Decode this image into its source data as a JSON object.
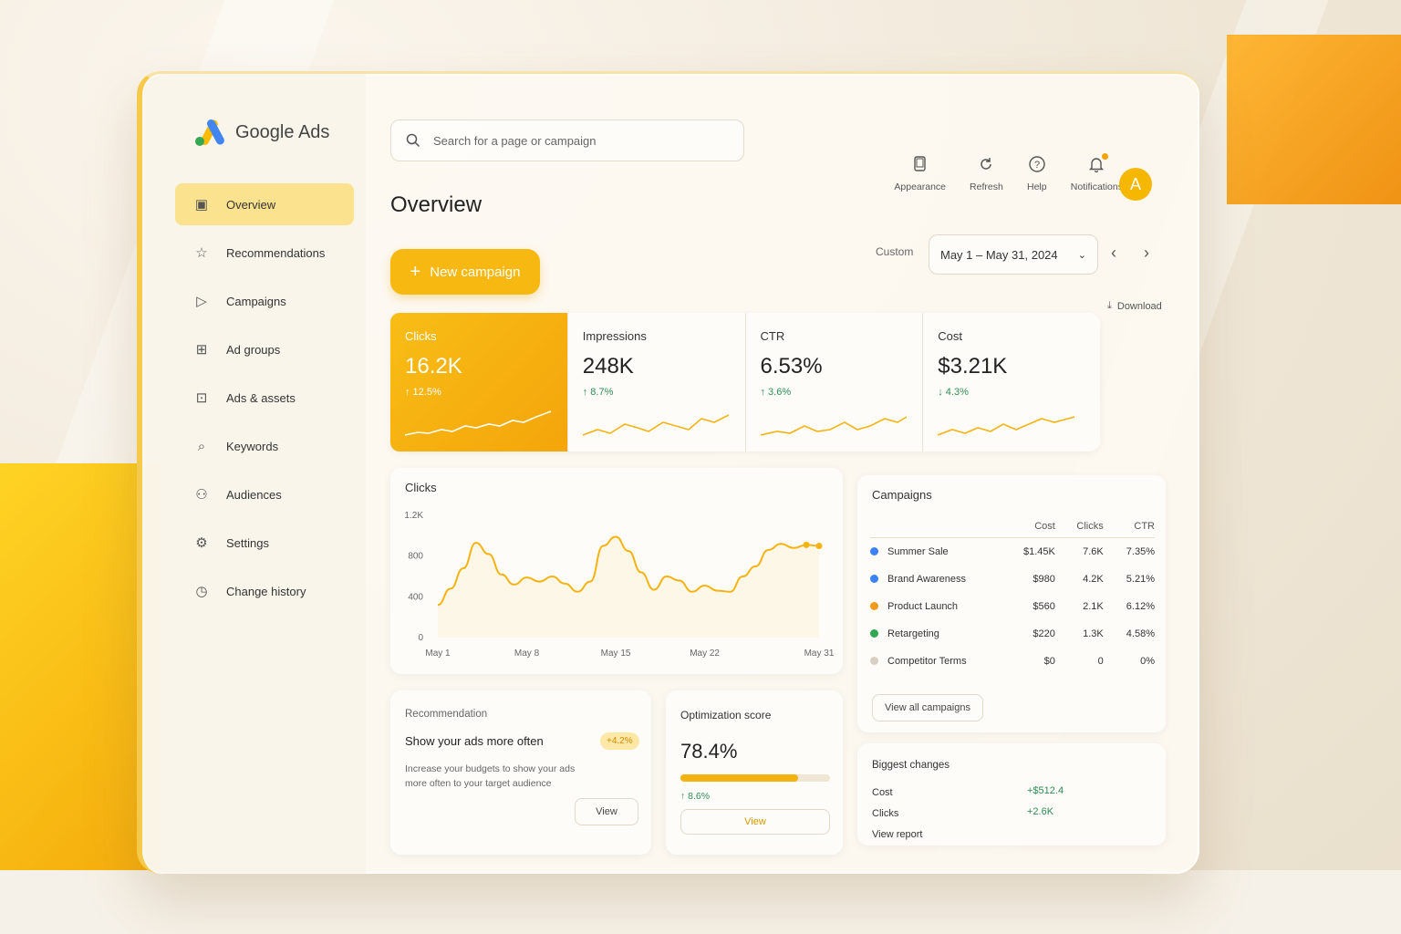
{
  "app": {
    "name": "Google Ads"
  },
  "search": {
    "placeholder": "Search for a page or campaign"
  },
  "sidebar": {
    "items": [
      {
        "label": "Overview",
        "icon": "overview-icon"
      },
      {
        "label": "Recommendations",
        "icon": "star-icon"
      },
      {
        "label": "Campaigns",
        "icon": "campaigns-play-icon"
      },
      {
        "label": "Ad groups",
        "icon": "ad-groups-icon"
      },
      {
        "label": "Ads & assets",
        "icon": "ads-assets-icon"
      },
      {
        "label": "Keywords",
        "icon": "keywords-icon"
      },
      {
        "label": "Audiences",
        "icon": "audiences-icon"
      },
      {
        "label": "Settings",
        "icon": "gear-icon"
      },
      {
        "label": "Change history",
        "icon": "history-icon"
      }
    ]
  },
  "header": {
    "title": "Overview",
    "appearance": "Appearance",
    "refresh": "Refresh",
    "help": "Help",
    "notifications": "Notifications",
    "avatar": "A",
    "new_campaign": "New campaign",
    "range_label": "Custom",
    "date_range": "May 1 – May 31, 2024",
    "download": "Download"
  },
  "kpis": [
    {
      "label": "Clicks",
      "value": "16.2K",
      "delta": "↑ 12.5%"
    },
    {
      "label": "Impressions",
      "value": "248K",
      "delta": "↑ 8.7%"
    },
    {
      "label": "CTR",
      "value": "6.53%",
      "delta": "↑ 3.6%"
    },
    {
      "label": "Cost",
      "value": "$3.21K",
      "delta": "↓ 4.3%"
    }
  ],
  "chart_data": {
    "type": "line",
    "title": "Clicks",
    "x": [
      "May 1",
      "May 2",
      "May 3",
      "May 4",
      "May 5",
      "May 6",
      "May 7",
      "May 8",
      "May 9",
      "May 10",
      "May 11",
      "May 12",
      "May 13",
      "May 14",
      "May 15",
      "May 16",
      "May 17",
      "May 18",
      "May 19",
      "May 20",
      "May 21",
      "May 22",
      "May 23",
      "May 24",
      "May 25",
      "May 26",
      "May 27",
      "May 28",
      "May 29",
      "May 30",
      "May 31"
    ],
    "xticks": [
      "May 1",
      "May 8",
      "May 15",
      "May 22",
      "May 31"
    ],
    "series": [
      {
        "values": [
          320,
          480,
          680,
          930,
          820,
          620,
          520,
          590,
          550,
          600,
          530,
          450,
          550,
          900,
          990,
          850,
          640,
          470,
          600,
          560,
          450,
          510,
          460,
          450,
          600,
          700,
          860,
          920,
          880,
          910,
          900
        ]
      }
    ],
    "yticks": [
      "0",
      "400",
      "800",
      "1.2K"
    ],
    "ylim": [
      0,
      1200
    ],
    "color": "#f5b311",
    "grid": false
  },
  "campaigns": {
    "title": "Campaigns",
    "columns": [
      "Cost",
      "Clicks",
      "CTR"
    ],
    "rows": [
      {
        "name": "Summer Sale",
        "cost": "$1.45K",
        "clicks": "7.6K",
        "ctr": "7.35%",
        "color": "#3b82f6"
      },
      {
        "name": "Brand Awareness",
        "cost": "$980",
        "clicks": "4.2K",
        "ctr": "5.21%",
        "color": "#3b82f6"
      },
      {
        "name": "Product Launch",
        "cost": "$560",
        "clicks": "2.1K",
        "ctr": "6.12%",
        "color": "#f29b1d"
      },
      {
        "name": "Retargeting",
        "cost": "$220",
        "clicks": "1.3K",
        "ctr": "4.58%",
        "color": "#2fa84f"
      },
      {
        "name": "Competitor Terms",
        "cost": "$0",
        "clicks": "0",
        "ctr": "0%",
        "color": "#d7d0c2"
      }
    ],
    "view_all": "View all campaigns"
  },
  "recommendation": {
    "section": "Recommendation",
    "title": "Show your ads more often",
    "badge": "+4.2%",
    "desc1": "Increase your budgets to show your ads",
    "desc2": "more often to your target audience",
    "view": "View"
  },
  "optimization": {
    "title": "Optimization score",
    "value": "78.4%",
    "progress": 0.784,
    "delta": "↑ 8.6%",
    "view": "View"
  },
  "changes": {
    "title": "Biggest changes",
    "rows": [
      {
        "label": "Cost",
        "value": "+$512.4"
      },
      {
        "label": "Clicks",
        "value": "+2.6K"
      }
    ],
    "view_report": "View report"
  },
  "colors": {
    "accent": "#f5b311",
    "positive": "#2e8b57"
  }
}
